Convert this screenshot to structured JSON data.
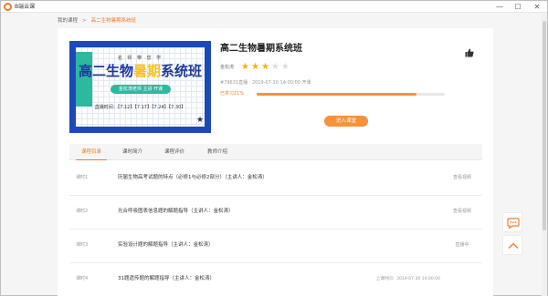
{
  "window": {
    "app_title": "B端云课",
    "minimize_glyph": "—",
    "maximize_glyph": "☐",
    "close_glyph": "✕"
  },
  "breadcrumb": {
    "root": "我的课程",
    "separator": ">",
    "current": "高二生物暑期系统班"
  },
  "banner": {
    "tag": "名 师 带 您 学",
    "title_part1": "高二生物",
    "title_highlight": "暑期",
    "title_part2": "系统班",
    "pill": "金松涛老师 主讲 开课",
    "schedule": "直播时间：【7.12】【7.17】【7.24】【7.30】"
  },
  "course": {
    "title": "高二生物暑期系统班",
    "teacher_label": "金松涛",
    "rating": 3,
    "rating_max": 5,
    "schedule": "#79631直播 · 2019-07-30 14:00:00 开课",
    "progress_label": "已学习21%",
    "progress_percent": 0.85,
    "enter_button": "进入课堂"
  },
  "tabs": [
    {
      "label": "课程目录",
      "active": true
    },
    {
      "label": "课时简介",
      "active": false
    },
    {
      "label": "课程评价",
      "active": false
    },
    {
      "label": "教师介绍",
      "active": false
    }
  ],
  "lessons": [
    {
      "num": "课时1",
      "title": "历届生物高考试题的特点（必修1与必修2部分）（主讲人：金松涛）",
      "time": "",
      "status": "查看视频"
    },
    {
      "num": "课时2",
      "title": "光合呼吸图表信息题的解题指导（主讲人：金松涛）",
      "time": "",
      "status": "查看视频"
    },
    {
      "num": "课时3",
      "title": "实验设计题的解题指导（主讲人：金松涛）",
      "time": "",
      "status": "直播中"
    },
    {
      "num": "课时4",
      "title": "31题遗传题的解题指导（主讲人：金松涛）",
      "time": "上课时间：2019-07-30 14:00:00",
      "status": ""
    }
  ],
  "icons": {
    "app": "cloud-class-logo-icon",
    "thumb": "thumbs-up-icon",
    "chat": "chat-bubble-icon",
    "top": "chevron-up-icon"
  },
  "colors": {
    "accent": "#f37b2a",
    "banner_blue": "#1d49b8",
    "banner_teal": "#2db8a0",
    "star": "#f5b400"
  }
}
